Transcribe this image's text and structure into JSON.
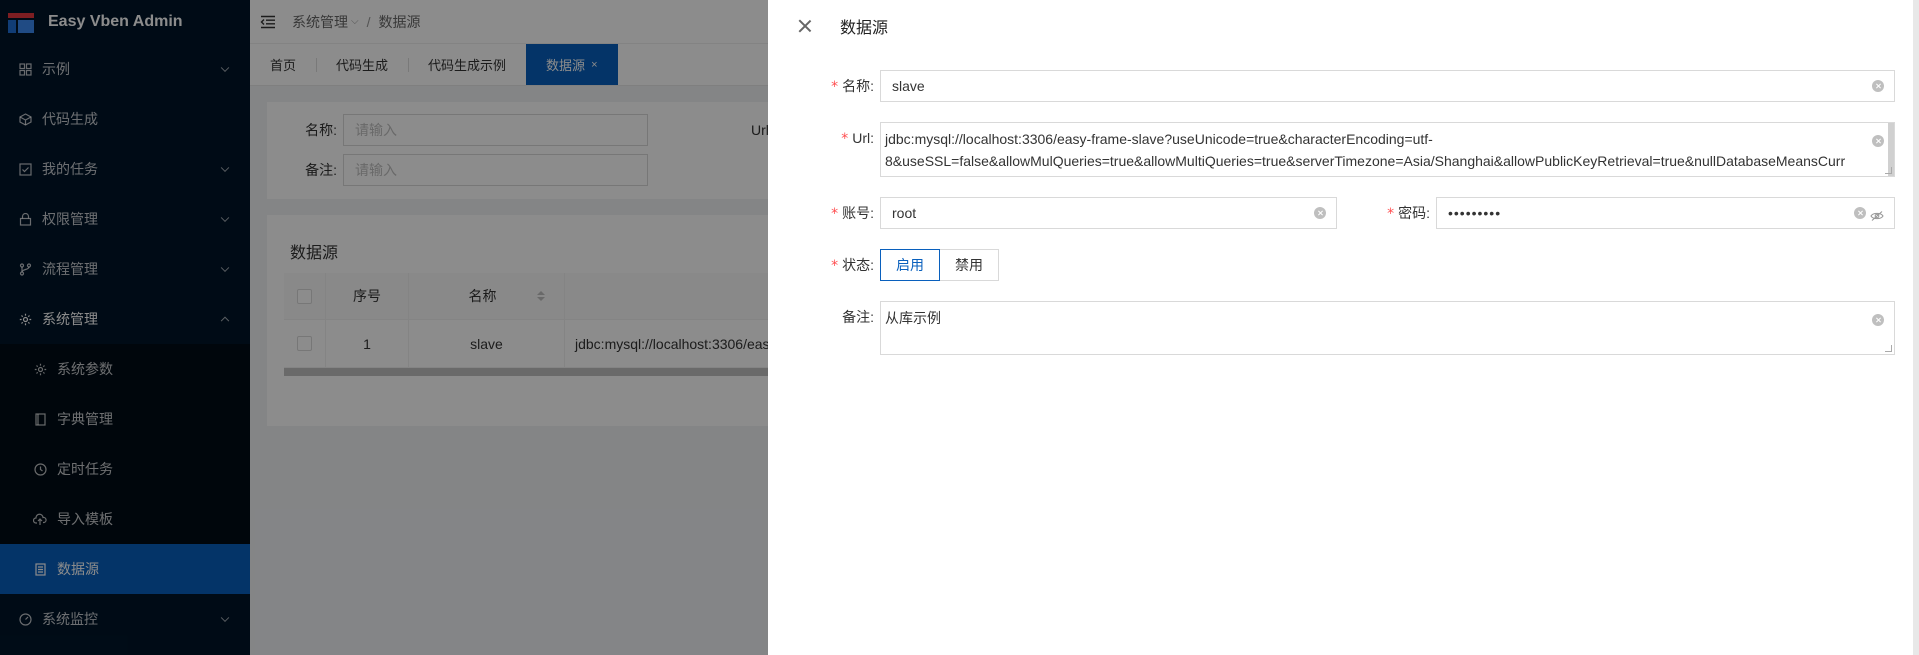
{
  "app": {
    "title": "Easy Vben Admin"
  },
  "sidebar": {
    "items": [
      {
        "label": "示例"
      },
      {
        "label": "代码生成"
      },
      {
        "label": "我的任务"
      },
      {
        "label": "权限管理"
      },
      {
        "label": "流程管理"
      },
      {
        "label": "系统管理"
      },
      {
        "label": "系统监控"
      }
    ],
    "submenu": [
      {
        "label": "系统参数"
      },
      {
        "label": "字典管理"
      },
      {
        "label": "定时任务"
      },
      {
        "label": "导入模板"
      },
      {
        "label": "数据源"
      }
    ]
  },
  "header": {
    "breadcrumb": [
      "系统管理",
      "数据源"
    ],
    "sep": "/"
  },
  "tabs": [
    {
      "label": "首页"
    },
    {
      "label": "代码生成"
    },
    {
      "label": "代码生成示例"
    },
    {
      "label": "数据源",
      "close": "×"
    }
  ],
  "search": {
    "name_label": "名称:",
    "remark_label": "备注:",
    "url_label": "Url",
    "placeholder": "请输入"
  },
  "table": {
    "title": "数据源",
    "columns": [
      "序号",
      "名称"
    ],
    "rows": [
      {
        "index": "1",
        "name": "slave",
        "url": "jdbc:mysql://localhost:3306/eas"
      }
    ]
  },
  "drawer": {
    "title": "数据源",
    "required_mark": "*",
    "name": {
      "label": "名称:",
      "value": "slave"
    },
    "url": {
      "label": "Url:",
      "line1": "jdbc:mysql://localhost:3306/easy-frame-slave?useUnicode=true&characterEncoding=utf-",
      "line2": "8&useSSL=false&allowMulQueries=true&allowMultiQueries=true&serverTimezone=Asia/Shanghai&allowPublicKeyRetrieval=true&nullDatabaseMeansCurr"
    },
    "account": {
      "label": "账号:",
      "value": "root"
    },
    "password": {
      "label": "密码:",
      "value": "•••••••••"
    },
    "status": {
      "label": "状态:",
      "options": [
        "启用",
        "禁用"
      ],
      "selected": "启用"
    },
    "remark": {
      "label": "备注:",
      "value": "从库示例"
    }
  },
  "colors": {
    "sidebar": "#001529",
    "accent": "#0960bd",
    "required": "#ff4d4f"
  }
}
